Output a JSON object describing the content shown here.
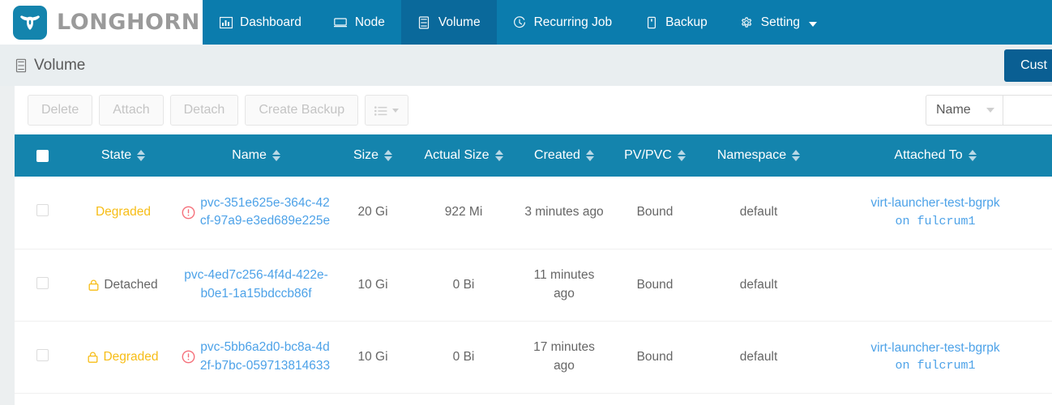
{
  "brand": {
    "name": "LONGHORN",
    "logo_icon": "longhorn-bull-icon",
    "logo_bg": "#1484ad"
  },
  "nav": {
    "accent": "#0b7cad",
    "active_bg": "#0a699b",
    "items": [
      {
        "label": "Dashboard",
        "icon": "bar-chart-icon",
        "active": false,
        "caret": false
      },
      {
        "label": "Node",
        "icon": "server-icon",
        "active": false,
        "caret": false
      },
      {
        "label": "Volume",
        "icon": "database-icon",
        "active": true,
        "caret": false
      },
      {
        "label": "Recurring Job",
        "icon": "clock-icon",
        "active": false,
        "caret": false
      },
      {
        "label": "Backup",
        "icon": "archive-icon",
        "active": false,
        "caret": false
      },
      {
        "label": "Setting",
        "icon": "gear-icon",
        "active": false,
        "caret": true
      }
    ]
  },
  "page": {
    "title": "Volume",
    "title_icon": "volume-icon",
    "customize_button": "Cust",
    "customize_bg": "#0a5f93"
  },
  "toolbar": {
    "buttons": [
      {
        "label": "Delete"
      },
      {
        "label": "Attach"
      },
      {
        "label": "Detach"
      },
      {
        "label": "Create Backup"
      }
    ],
    "list_menu_icon": "list-icon",
    "filter_field": "Name",
    "search_value": ""
  },
  "table": {
    "columns": [
      {
        "label": "",
        "key": "check",
        "sortable": false
      },
      {
        "label": "State",
        "key": "state",
        "sortable": true
      },
      {
        "label": "Name",
        "key": "name",
        "sortable": true
      },
      {
        "label": "Size",
        "key": "size",
        "sortable": true
      },
      {
        "label": "Actual Size",
        "key": "actual",
        "sortable": true
      },
      {
        "label": "Created",
        "key": "created",
        "sortable": true
      },
      {
        "label": "PV/PVC",
        "key": "pvpvc",
        "sortable": true
      },
      {
        "label": "Namespace",
        "key": "ns",
        "sortable": true
      },
      {
        "label": "Attached To",
        "key": "attached",
        "sortable": true
      }
    ],
    "rows": [
      {
        "checked": false,
        "state": "Degraded",
        "state_color": "degraded",
        "locked": false,
        "warning": true,
        "name": "pvc-351e625e-364c-42cf-97a9-e3ed689e225e",
        "size": "20 Gi",
        "actual_size": "922 Mi",
        "created": "3 minutes ago",
        "pvpvc": "Bound",
        "namespace": "default",
        "attached_pod": "virt-launcher-test-bgrpk",
        "attached_host": "on fulcrum1"
      },
      {
        "checked": false,
        "state": "Detached",
        "state_color": "detached",
        "locked": true,
        "warning": false,
        "name": "pvc-4ed7c256-4f4d-422e-b0e1-1a15bdccb86f",
        "size": "10 Gi",
        "actual_size": "0 Bi",
        "created": "11 minutes ago",
        "pvpvc": "Bound",
        "namespace": "default",
        "attached_pod": "",
        "attached_host": ""
      },
      {
        "checked": false,
        "state": "Degraded",
        "state_color": "degraded",
        "locked": true,
        "warning": true,
        "name": "pvc-5bb6a2d0-bc8a-4d2f-b7bc-059713814633",
        "size": "10 Gi",
        "actual_size": "0 Bi",
        "created": "17 minutes ago",
        "pvpvc": "Bound",
        "namespace": "default",
        "attached_pod": "virt-launcher-test-bgrpk",
        "attached_host": "on fulcrum1"
      }
    ]
  },
  "colors": {
    "nav_blue": "#0b7cad",
    "table_header_blue": "#1484ad",
    "link_blue": "#4da2e8",
    "warning_yellow": "#f7bd16",
    "error_red": "#f5707a",
    "page_bg": "#e9eef0"
  }
}
